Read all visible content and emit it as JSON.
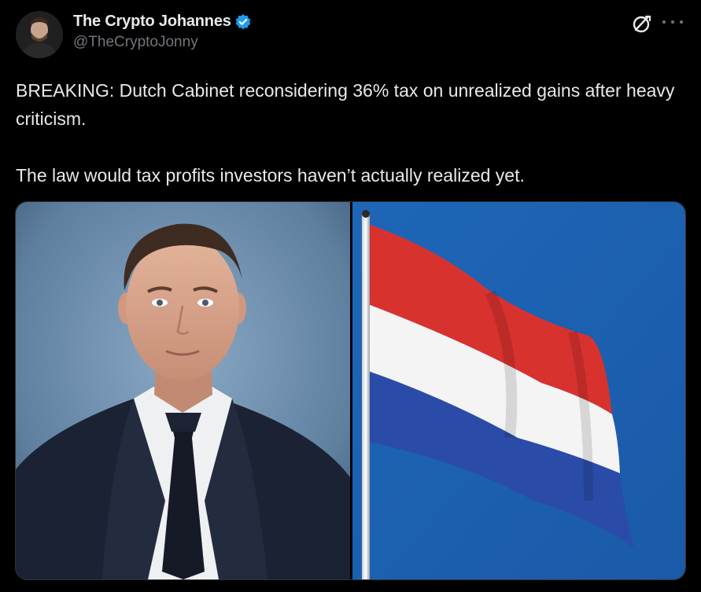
{
  "author": {
    "display_name": "The Crypto Johannes",
    "handle": "@TheCryptoJonny",
    "verified": true,
    "verified_color": "#1d9bf0"
  },
  "icons": {
    "avatar": "avatar-photo",
    "verified": "verified-badge-icon",
    "grok": "grok-icon",
    "more": "more-options-icon"
  },
  "tweet": {
    "paragraph_1": "BREAKING: Dutch Cabinet reconsidering 36% tax on unrealized gains after heavy criticism.",
    "paragraph_2": "The law would tax profits investors haven’t actually realized yet."
  },
  "media": {
    "images": [
      "portrait-photo",
      "dutch-flag-photo"
    ],
    "flag_colors": [
      "#d8322f",
      "#f4f4f4",
      "#2a4ca8"
    ],
    "sky_color": "#1f66b8"
  }
}
